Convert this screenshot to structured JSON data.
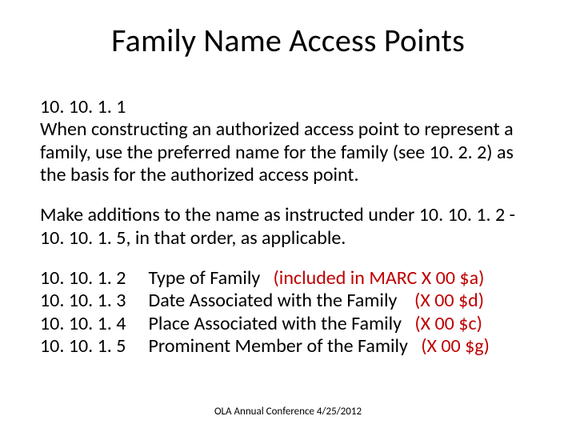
{
  "title": "Family Name Access Points",
  "section_number": "10. 10. 1. 1",
  "para1": "When constructing an authorized access point to represent a family, use the preferred name for the family (see 10. 2. 2) as the basis for the authorized access point.",
  "para2": "Make additions to the name as instructed under 10. 10. 1. 2 - 10. 10. 1. 5, in that order, as applicable.",
  "items": [
    {
      "num": "10. 10. 1. 2",
      "label": "Type of Family",
      "marc": "(included in MARC X 00 $a)"
    },
    {
      "num": "10. 10. 1. 3",
      "label": "Date Associated with the Family",
      "marc": "(X 00 $d)"
    },
    {
      "num": "10. 10. 1. 4",
      "label": "Place Associated with the Family",
      "marc": "(X 00 $c)"
    },
    {
      "num": "10. 10. 1. 5",
      "label": "Prominent Member of the Family",
      "marc": "(X 00 $g)"
    }
  ],
  "footer": "OLA Annual Conference 4/25/2012"
}
